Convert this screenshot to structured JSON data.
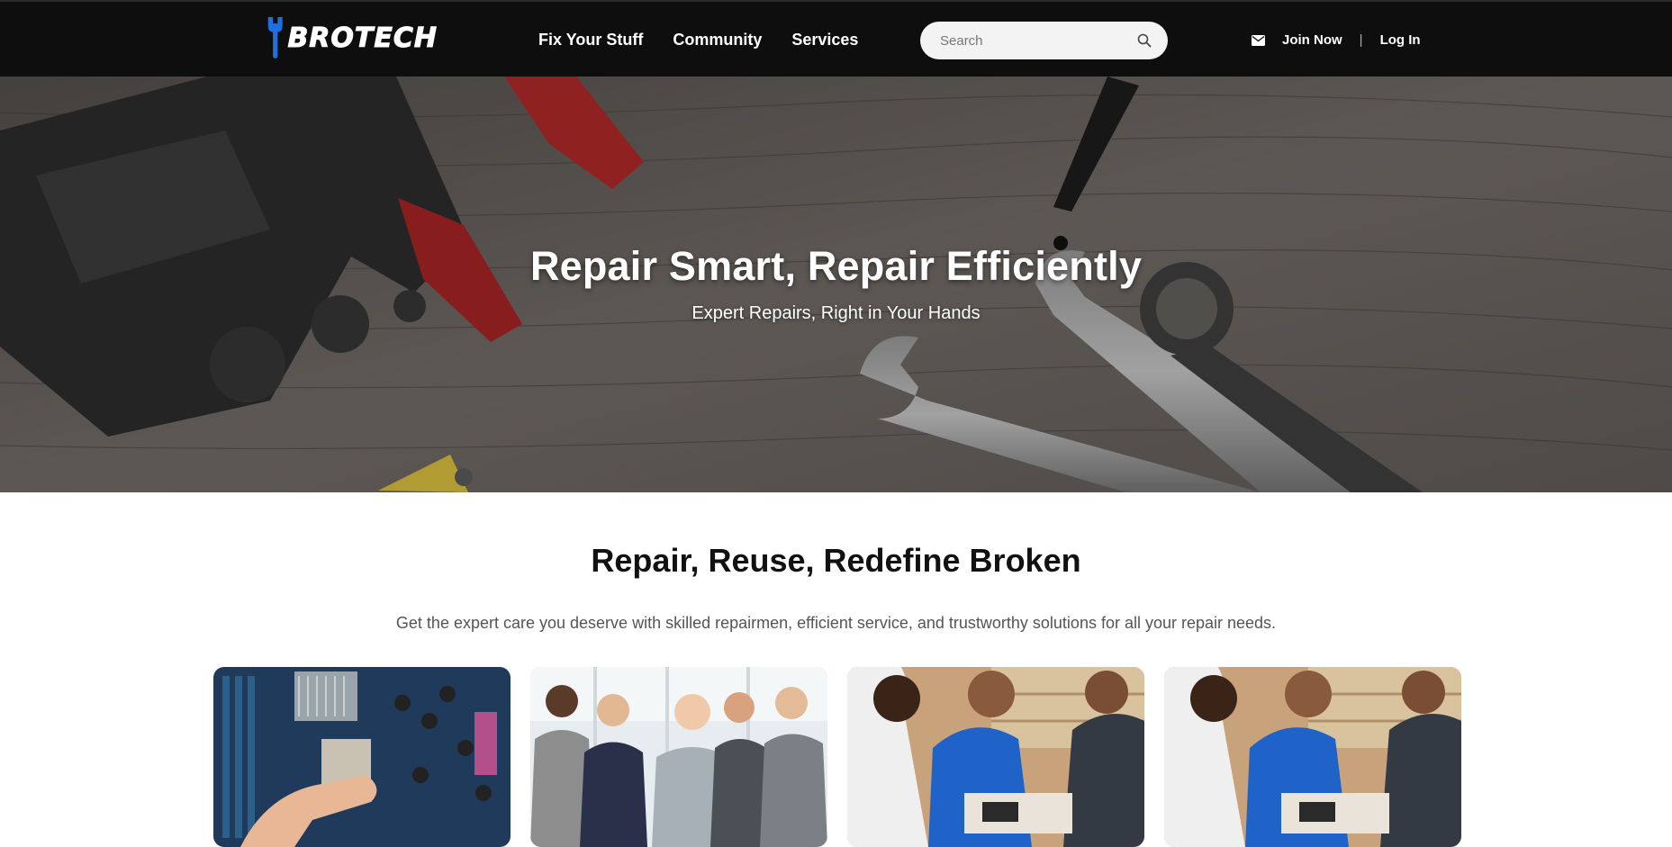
{
  "brand": {
    "name": "BROTECH",
    "accent": "#1e6fe0"
  },
  "nav": {
    "items": [
      {
        "label": "Fix Your Stuff"
      },
      {
        "label": "Community"
      },
      {
        "label": "Services"
      }
    ]
  },
  "search": {
    "placeholder": "Search",
    "icon": "search-icon"
  },
  "account": {
    "mail_icon": "mail-icon",
    "join_label": "Join Now",
    "separator": "|",
    "login_label": "Log In"
  },
  "hero": {
    "title": "Repair Smart, Repair Efficiently",
    "subtitle": "Expert Repairs, Right in Your Hands"
  },
  "intro": {
    "title": "Repair, Reuse, Redefine Broken",
    "description": "Get the expert care you deserve with skilled repairmen, efficient service, and trustworthy solutions for all your repair needs."
  },
  "cards": [
    {
      "image": "circuit-board-repair"
    },
    {
      "image": "business-team"
    },
    {
      "image": "technicians-repairing"
    },
    {
      "image": "technicians-repairing"
    }
  ]
}
